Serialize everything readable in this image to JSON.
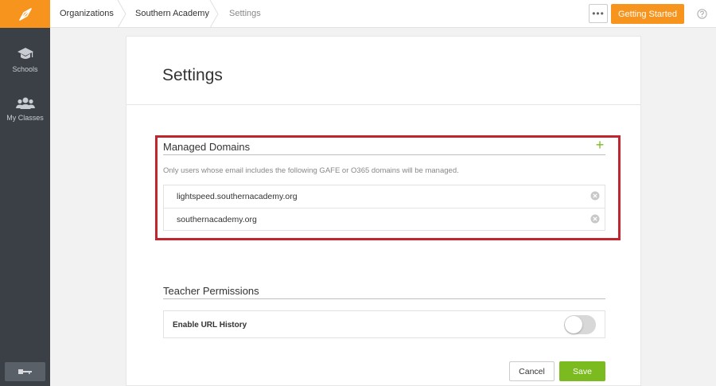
{
  "sidebar": {
    "items": [
      {
        "label": "Schools",
        "icon": "graduation-cap-icon"
      },
      {
        "label": "My Classes",
        "icon": "users-icon"
      }
    ]
  },
  "breadcrumb": [
    {
      "label": "Organizations"
    },
    {
      "label": "Southern Academy"
    },
    {
      "label": "Settings"
    }
  ],
  "header": {
    "more_label": "•••",
    "getting_started_label": "Getting Started"
  },
  "page": {
    "title": "Settings"
  },
  "managed_domains": {
    "title": "Managed Domains",
    "add_label": "+",
    "hint": "Only users whose email includes the following GAFE or O365 domains will be managed.",
    "domains": [
      "lightspeed.southernacademy.org",
      "southernacademy.org"
    ]
  },
  "teacher_permissions": {
    "title": "Teacher Permissions",
    "url_history_label": "Enable URL History",
    "url_history_enabled": false
  },
  "actions": {
    "cancel_label": "Cancel",
    "save_label": "Save"
  },
  "colors": {
    "brand_orange": "#f7941d",
    "sidebar_bg": "#3b4046",
    "accent_green": "#7cbb1f",
    "highlight_red": "#c0262d"
  }
}
